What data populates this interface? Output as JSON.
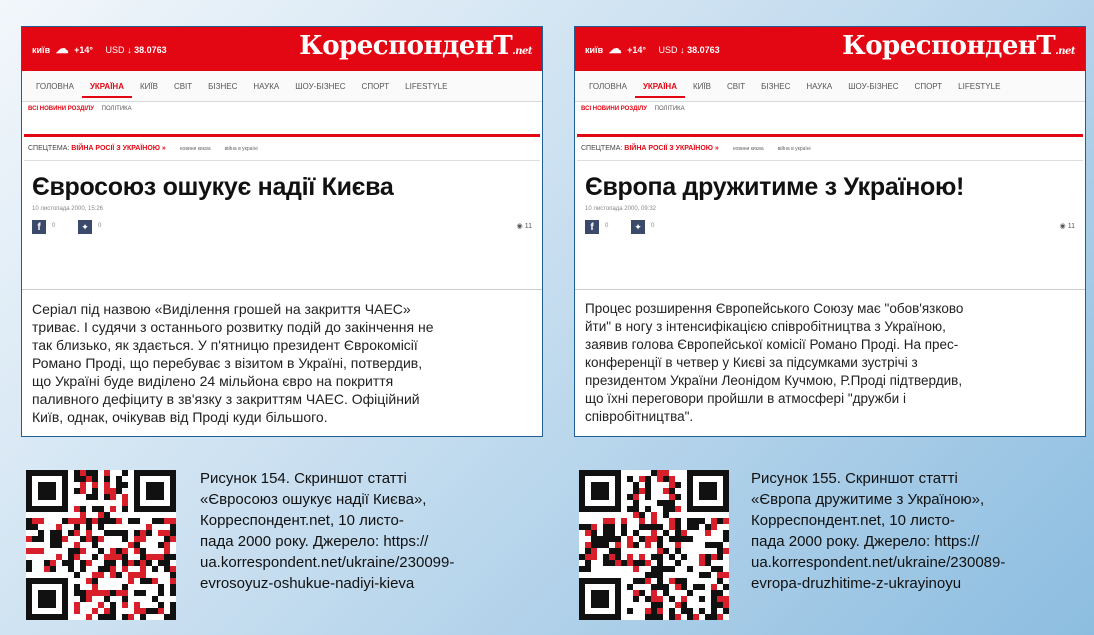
{
  "articles": [
    {
      "topbar": {
        "weather_city": "київ",
        "temp": "+14°",
        "usd": "USD",
        "rate": "↓ 38.0763"
      },
      "logo": {
        "name": "КореспонденТ",
        "suffix": ".net"
      },
      "nav": [
        "ГОЛОВНА",
        "УКРАЇНА",
        "КИЇВ",
        "СВІТ",
        "БІЗНЕС",
        "НАУКА",
        "ШОУ-БІЗНЕС",
        "СПОРТ",
        "LIFESTYLE"
      ],
      "crumbs": {
        "all": "ВСІ НОВИНИ РОЗДІЛУ",
        "section": "ПОЛІТИКА"
      },
      "special": {
        "label": "СПЕЦТЕМА:",
        "topic": "ВІЙНА РОСІЇ З УКРАЇНОЮ »",
        "sub1": "новини києва",
        "sub2": "війна в україні"
      },
      "headline": "Євросоюз ошукує надії Києва",
      "date": "10 листопада 2000, 15:26",
      "social": {
        "fb_count": "0",
        "tw_count": "0",
        "views": "11"
      },
      "body_lines": [
        "Серіал під назвою «Виділення грошей на закриття ЧАЕС»",
        "триває. І судячи з останнього розвитку подій до закінчення не",
        "так близько, як здається. У п'ятницю президент Єврокомісії",
        "Романо Проді, що перебуває з візитом в Україні, потвердив,",
        "що Україні буде виділено 24 мільйона євро на покриття",
        "паливного дефіциту в зв'язку з закриттям ЧАЕС. Офіційний",
        "Київ, однак, очікував від Проді куди більшого."
      ]
    },
    {
      "topbar": {
        "weather_city": "київ",
        "temp": "+14°",
        "usd": "USD",
        "rate": "↓ 38.0763"
      },
      "logo": {
        "name": "КореспонденТ",
        "suffix": ".net"
      },
      "nav": [
        "ГОЛОВНА",
        "УКРАЇНА",
        "КИЇВ",
        "СВІТ",
        "БІЗНЕС",
        "НАУКА",
        "ШОУ-БІЗНЕС",
        "СПОРТ",
        "LIFESTYLE"
      ],
      "crumbs": {
        "all": "ВСІ НОВИНИ РОЗДІЛУ",
        "section": "ПОЛІТИКА"
      },
      "special": {
        "label": "СПЕЦТЕМА:",
        "topic": "ВІЙНА РОСІЇ З УКРАЇНОЮ »",
        "sub1": "новини києва",
        "sub2": "війна в україні"
      },
      "headline": "Європа дружитиме з Україною!",
      "date": "10 листопада 2000, 09:32",
      "social": {
        "fb_count": "0",
        "tw_count": "0",
        "views": "11"
      },
      "body_lines": [
        "Процес розширення Європейського Союзу має \"обов'язково",
        "йти\" в ногу з інтенсифікацією співробітництва з Україною,",
        "заявив голова Європейської комісії Романо Проді. На прес-",
        "конференції в четвер у Києві за підсумками зустрічі з",
        "президентом України Леонідом Кучмою, Р.Проді підтвердив,",
        "що їхні переговори пройшли в атмосфері \"дружби і",
        "співробітництва\"."
      ]
    }
  ],
  "captions": [
    {
      "lines": [
        "Рисунок 154. Скриншот статті",
        "«Євросоюз ошукує надії Києва»,",
        "Корреспондент.net, 10 листо-",
        "пада 2000 року. Джерело: https://",
        "ua.korrespondent.net/ukraine/230099-",
        "evrosoyuz-oshukue-nadiyi-kieva"
      ]
    },
    {
      "lines": [
        "Рисунок 155. Скриншот статті",
        "«Європа дружитиме з Україною»,",
        "Корреспондент.net, 10 листо-",
        "пада 2000 року. Джерело: https://",
        "ua.korrespondent.net/ukraine/230089-",
        "evropa-druzhitime-z-ukrayinoyu"
      ]
    }
  ],
  "colors": {
    "brand_red": "#e30613",
    "qr_dark": "#111111",
    "qr_red": "#d8202a"
  },
  "icons": [
    "cloud-icon",
    "facebook-icon",
    "twitter-icon",
    "eye-icon",
    "qr-code"
  ]
}
